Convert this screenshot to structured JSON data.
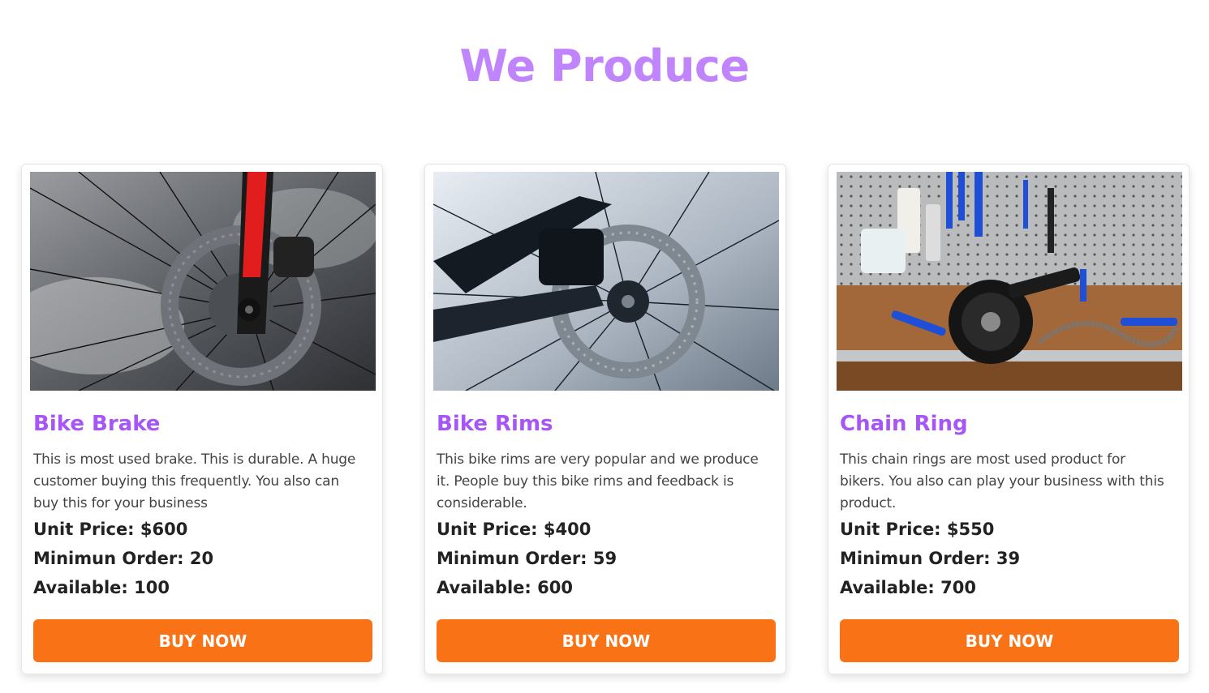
{
  "section": {
    "title": "We Produce"
  },
  "products": [
    {
      "name": "Bike Brake",
      "description": "This is most used brake. This is durable. A huge customer buying this frequently. You also can buy this for your business",
      "unit_price": "Unit Price: $600",
      "min_order": "Minimun Order: 20",
      "available": "Available: 100",
      "button": "BUY NOW"
    },
    {
      "name": "Bike Rims",
      "description": "This bike rims are very popular and we produce it. People buy this bike rims and feedback is considerable.",
      "unit_price": "Unit Price: $400",
      "min_order": "Minimun Order: 59",
      "available": "Available: 600",
      "button": "BUY NOW"
    },
    {
      "name": "Chain Ring",
      "description": "This chain rings are most used product for bikers. You also can play your business with this product.",
      "unit_price": "Unit Price: $550",
      "min_order": "Minimun Order: 39",
      "available": "Available: 700",
      "button": "BUY NOW"
    }
  ],
  "colors": {
    "heading": "#c084fc",
    "title": "#a855f7",
    "button": "#f97316"
  }
}
